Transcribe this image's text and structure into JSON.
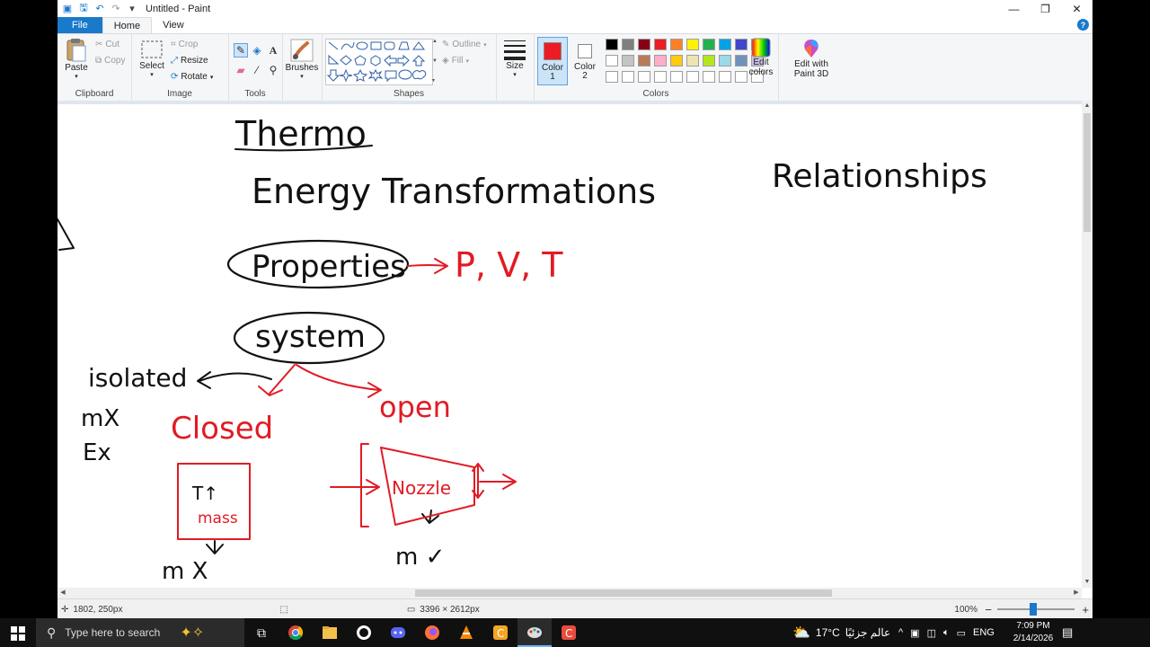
{
  "window": {
    "title": "Untitled - Paint"
  },
  "tabs": {
    "file": "File",
    "home": "Home",
    "view": "View"
  },
  "clipboard": {
    "label": "Clipboard",
    "paste": "Paste",
    "cut": "Cut",
    "copy": "Copy"
  },
  "image": {
    "label": "Image",
    "select": "Select",
    "crop": "Crop",
    "resize": "Resize",
    "rotate": "Rotate"
  },
  "tools": {
    "label": "Tools"
  },
  "brushes": {
    "label": "Brushes"
  },
  "shapes": {
    "label": "Shapes",
    "outline": "Outline",
    "fill": "Fill"
  },
  "size": {
    "label": "Size"
  },
  "color1": {
    "label": "Color",
    "num": "1",
    "value": "#ed1c24"
  },
  "color2": {
    "label": "Color",
    "num": "2",
    "value": "#ffffff"
  },
  "colors": {
    "label": "Colors",
    "edit_line1": "Edit",
    "edit_line2": "colors",
    "row1": [
      "#000000",
      "#7f7f7f",
      "#880015",
      "#ed1c24",
      "#ff7f27",
      "#fff200",
      "#22b14c",
      "#00a2e8",
      "#3f48cc",
      "#a349a4"
    ],
    "row2": [
      "#ffffff",
      "#c3c3c3",
      "#b97a57",
      "#ffaec9",
      "#ffc90e",
      "#efe4b0",
      "#b5e61d",
      "#99d9ea",
      "#7092be",
      "#c8bfe7"
    ]
  },
  "paint3d": {
    "line1": "Edit with",
    "line2": "Paint 3D"
  },
  "drawing": {
    "title": "Thermo",
    "subtitle": "Energy Transformations",
    "relationships": "Relationships",
    "properties": "Properties",
    "pvt": "P, V, T",
    "system": "system",
    "isolated": "isolated",
    "isolated_m": "mX",
    "isolated_e": "Ex",
    "closed": "Closed",
    "open": "open",
    "box_t": "T↑",
    "box_mass": "mass",
    "nozzle": "Nozzle",
    "closed_m": "m X",
    "open_m": "m ✓"
  },
  "statusbar": {
    "cursor": "1802, 250px",
    "dimensions": "3396 × 2612px",
    "zoom": "100%"
  },
  "taskbar": {
    "search_placeholder": "Type here to search",
    "weather_temp": "17°C",
    "weather_text": "عالم جزئيًا",
    "lang": "ENG",
    "time": "7:09 PM",
    "date": "2/14/2026"
  }
}
